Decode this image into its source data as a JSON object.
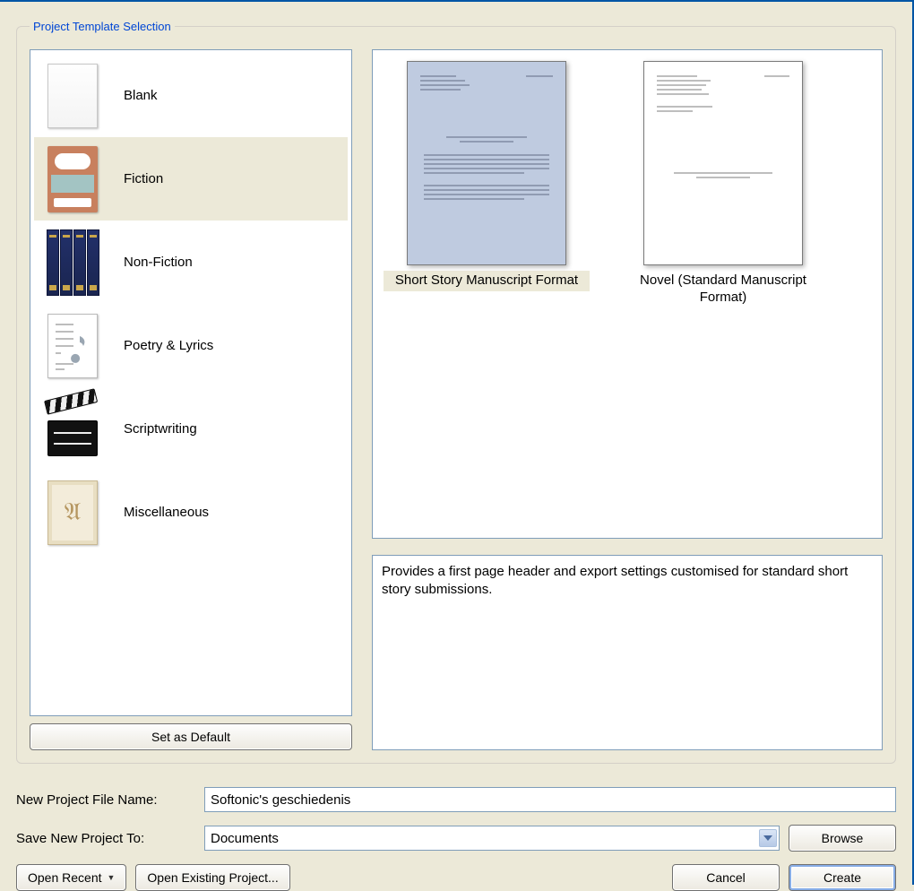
{
  "group_title": "Project Template Selection",
  "categories": [
    {
      "id": "blank",
      "label": "Blank",
      "selected": false
    },
    {
      "id": "fiction",
      "label": "Fiction",
      "selected": true
    },
    {
      "id": "nonfiction",
      "label": "Non-Fiction",
      "selected": false
    },
    {
      "id": "poetry",
      "label": "Poetry & Lyrics",
      "selected": false
    },
    {
      "id": "scriptwriting",
      "label": "Scriptwriting",
      "selected": false
    },
    {
      "id": "misc",
      "label": "Miscellaneous",
      "selected": false
    }
  ],
  "set_default_label": "Set as Default",
  "templates": [
    {
      "id": "short-story",
      "label": "Short Story Manuscript Format",
      "selected": true
    },
    {
      "id": "novel",
      "label": "Novel (Standard Manuscript Format)",
      "selected": false
    }
  ],
  "description": "Provides a first page header and export settings customised for standard short story submissions.",
  "form": {
    "file_name_label": "New Project File Name:",
    "file_name_value": "Softonic's geschiedenis",
    "save_to_label": "Save New Project To:",
    "save_to_value": "Documents",
    "browse_label": "Browse"
  },
  "buttons": {
    "open_recent": "Open Recent",
    "open_existing": "Open Existing Project...",
    "cancel": "Cancel",
    "create": "Create"
  }
}
